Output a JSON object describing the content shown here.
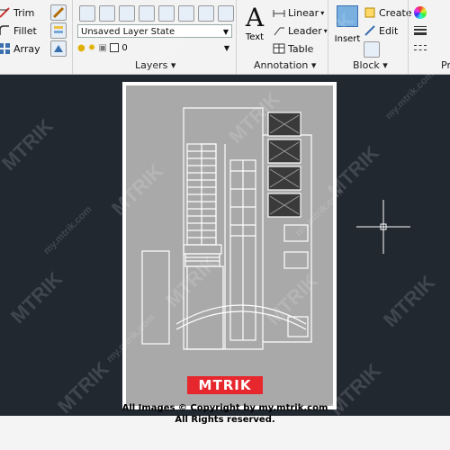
{
  "ribbon": {
    "modify": {
      "trim": "Trim",
      "fillet": "Fillet",
      "array": "Array"
    },
    "layers": {
      "state_value": "Unsaved Layer State",
      "current_layer": "0",
      "panel_title": "Layers"
    },
    "annotation": {
      "text": "Text",
      "linear": "Linear",
      "leader": "Leader",
      "table": "Table",
      "panel_title": "Annotation"
    },
    "block": {
      "insert": "Insert",
      "create": "Create",
      "edit": "Edit",
      "panel_title": "Block"
    },
    "properties": {
      "panel_title": "Pr"
    }
  },
  "colors": {
    "ribbon_bg": "#f3f3f3",
    "canvas_bg": "#212830",
    "paper_bg": "#a9a9a9",
    "logo_red": "#e6272d"
  },
  "icons": [
    "trim-icon",
    "fillet-icon",
    "array-icon",
    "layer-state-icon",
    "text-tool-icon",
    "insert-block-icon",
    "crosshair-cursor-icon"
  ],
  "watermark": {
    "brand": "MTRIK",
    "site": "my.mtrik.com"
  },
  "footer": {
    "logo_text": "MTRIK",
    "copyright": "All Images © Copyright by my.mtrik.com",
    "rights": "All Rights reserved."
  }
}
